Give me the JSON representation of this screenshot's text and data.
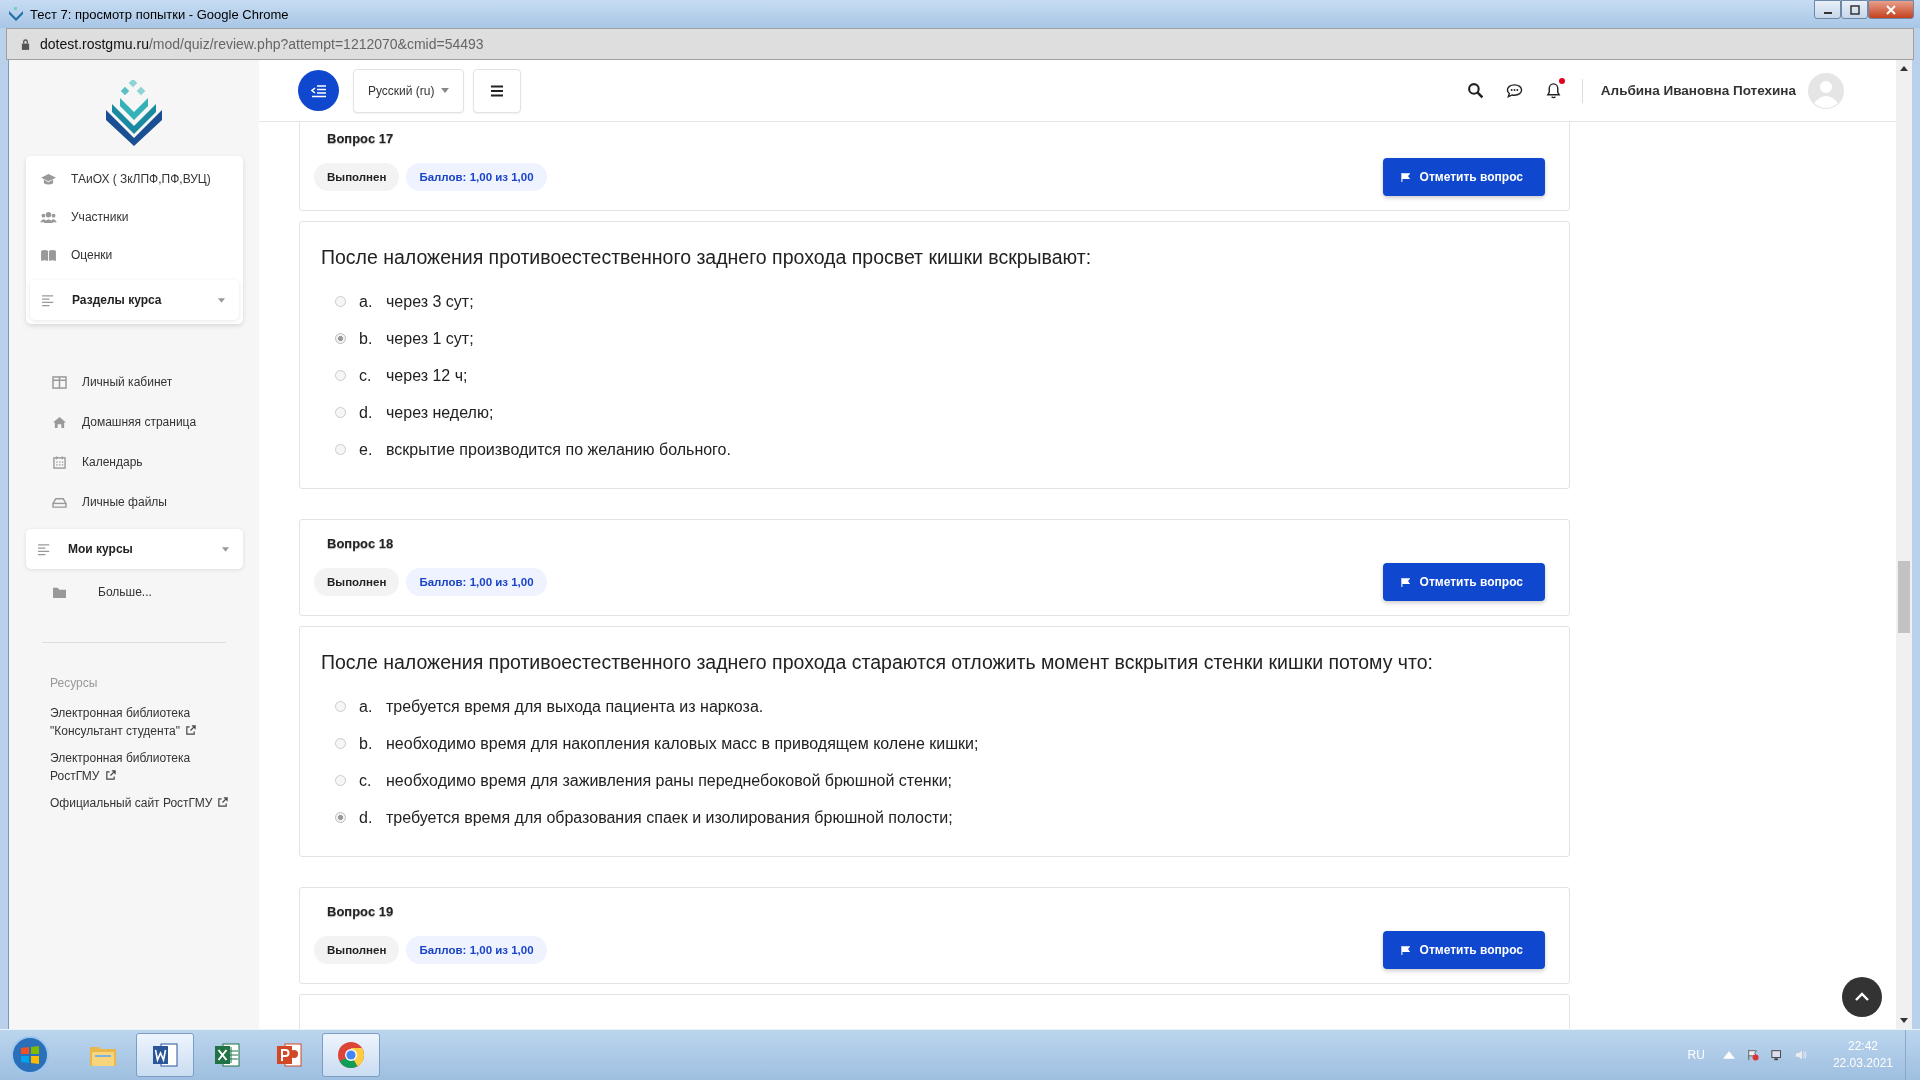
{
  "window": {
    "title": "Тест 7: просмотр попытки - Google Chrome"
  },
  "address_bar": {
    "host": "dotest.rostgmu.ru",
    "path": "/mod/quiz/review.php?attempt=1212070&cmid=54493"
  },
  "navbar": {
    "language": "Русский (ru)",
    "user_name": "Альбина Ивановна Потехина",
    "notification_unread": true
  },
  "sidebar": {
    "course_items": [
      {
        "label": "ТАиОХ ( ЗкЛПФ,ПФ,ВУЦ)"
      },
      {
        "label": "Участники"
      },
      {
        "label": "Оценки"
      }
    ],
    "course_sections": "Разделы курса",
    "nav_items": [
      {
        "label": "Личный кабинет"
      },
      {
        "label": "Домашняя страница"
      },
      {
        "label": "Календарь"
      },
      {
        "label": "Личные файлы"
      }
    ],
    "my_courses": "Мои курсы",
    "more": "Больше...",
    "resources_title": "Ресурсы",
    "resources": [
      {
        "label": "Электронная библиотека \"Консультант студента\""
      },
      {
        "label": "Электронная библиотека РостГМУ"
      },
      {
        "label": "Официальный сайт РостГМУ"
      }
    ]
  },
  "questions": [
    {
      "title": "Вопрос 17",
      "status": "Выполнен",
      "score": "Баллов: 1,00 из 1,00",
      "flag_button": "Отметить вопрос",
      "text": "После наложения противоестественного заднего прохода просвет кишки вскрывают:",
      "options": [
        {
          "letter": "a.",
          "text": "через 3 сут;",
          "selected": false
        },
        {
          "letter": "b.",
          "text": "через 1 сут;",
          "selected": true
        },
        {
          "letter": "c.",
          "text": "через 12 ч;",
          "selected": false
        },
        {
          "letter": "d.",
          "text": "через неделю;",
          "selected": false
        },
        {
          "letter": "e.",
          "text": "вскрытие производится по желанию больного.",
          "selected": false
        }
      ]
    },
    {
      "title": "Вопрос 18",
      "status": "Выполнен",
      "score": "Баллов: 1,00 из 1,00",
      "flag_button": "Отметить вопрос",
      "text": "После наложения противоестественного заднего прохода стараются отложить момент вскрытия стенки кишки потому что:",
      "options": [
        {
          "letter": "a.",
          "text": "требуется время для выхода пациента из наркоза.",
          "selected": false
        },
        {
          "letter": "b.",
          "text": "необходимо время для накопления каловых масс в приводящем колене кишки;",
          "selected": false
        },
        {
          "letter": "c.",
          "text": "необходимо время для заживления раны переднебоковой брюшной стенки;",
          "selected": false
        },
        {
          "letter": "d.",
          "text": "требуется время для образования спаек и изолирования брюшной полости;",
          "selected": true
        }
      ]
    },
    {
      "title": "Вопрос 19",
      "status": "Выполнен",
      "score": "Баллов: 1,00 из 1,00",
      "flag_button": "Отметить вопрос"
    }
  ],
  "taskbar": {
    "apps": [
      {
        "kind": "explorer",
        "running": false
      },
      {
        "kind": "word",
        "running": true
      },
      {
        "kind": "excel",
        "running": false
      },
      {
        "kind": "powerpoint",
        "running": false
      },
      {
        "kind": "chrome",
        "running": true
      }
    ],
    "language": "RU",
    "time": "22:42",
    "date": "22.03.2021"
  }
}
